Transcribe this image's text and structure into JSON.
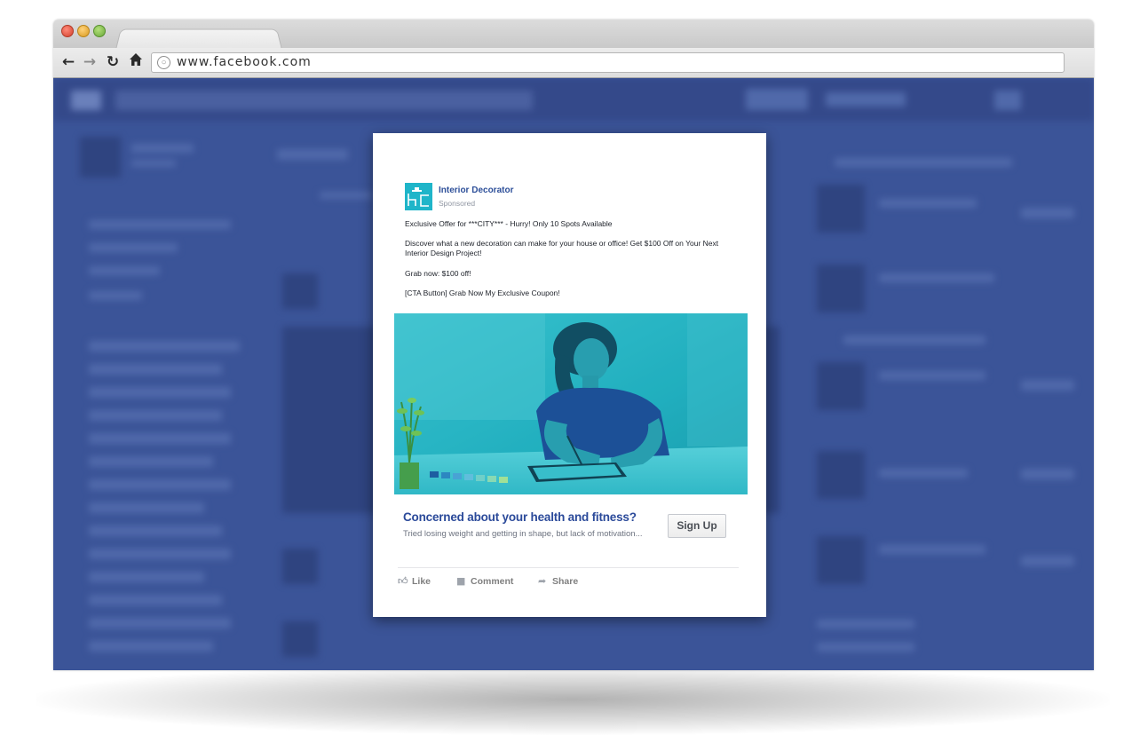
{
  "browser": {
    "url": "www.facebook.com"
  },
  "ad": {
    "page_name": "Interior Decorator",
    "sponsored_label": "Sponsored",
    "text_lines": [
      "Exclusive Offer for ***CITY*** - Hurry! Only 10 Spots Available",
      "Discover what a new decoration can make for your house or office! Get $100 Off on Your Next Interior Design Project!",
      "Grab now: $100 off!",
      "[CTA Button] Grab Now My Exclusive Coupon!"
    ],
    "headline": "Concerned about your health and fitness?",
    "description": "Tried losing weight and getting in shape, but lack of motivation...",
    "cta_label": "Sign Up",
    "actions": {
      "like": "Like",
      "comment": "Comment",
      "share": "Share"
    }
  },
  "colors": {
    "facebook_background": "#3b5498",
    "brand_blue": "#2d4f99",
    "image_tint": "#1fb5c9"
  },
  "icons": [
    "back-arrow-icon",
    "forward-arrow-icon",
    "reload-icon",
    "home-icon",
    "globe-icon",
    "like-icon",
    "comment-icon",
    "share-icon"
  ]
}
